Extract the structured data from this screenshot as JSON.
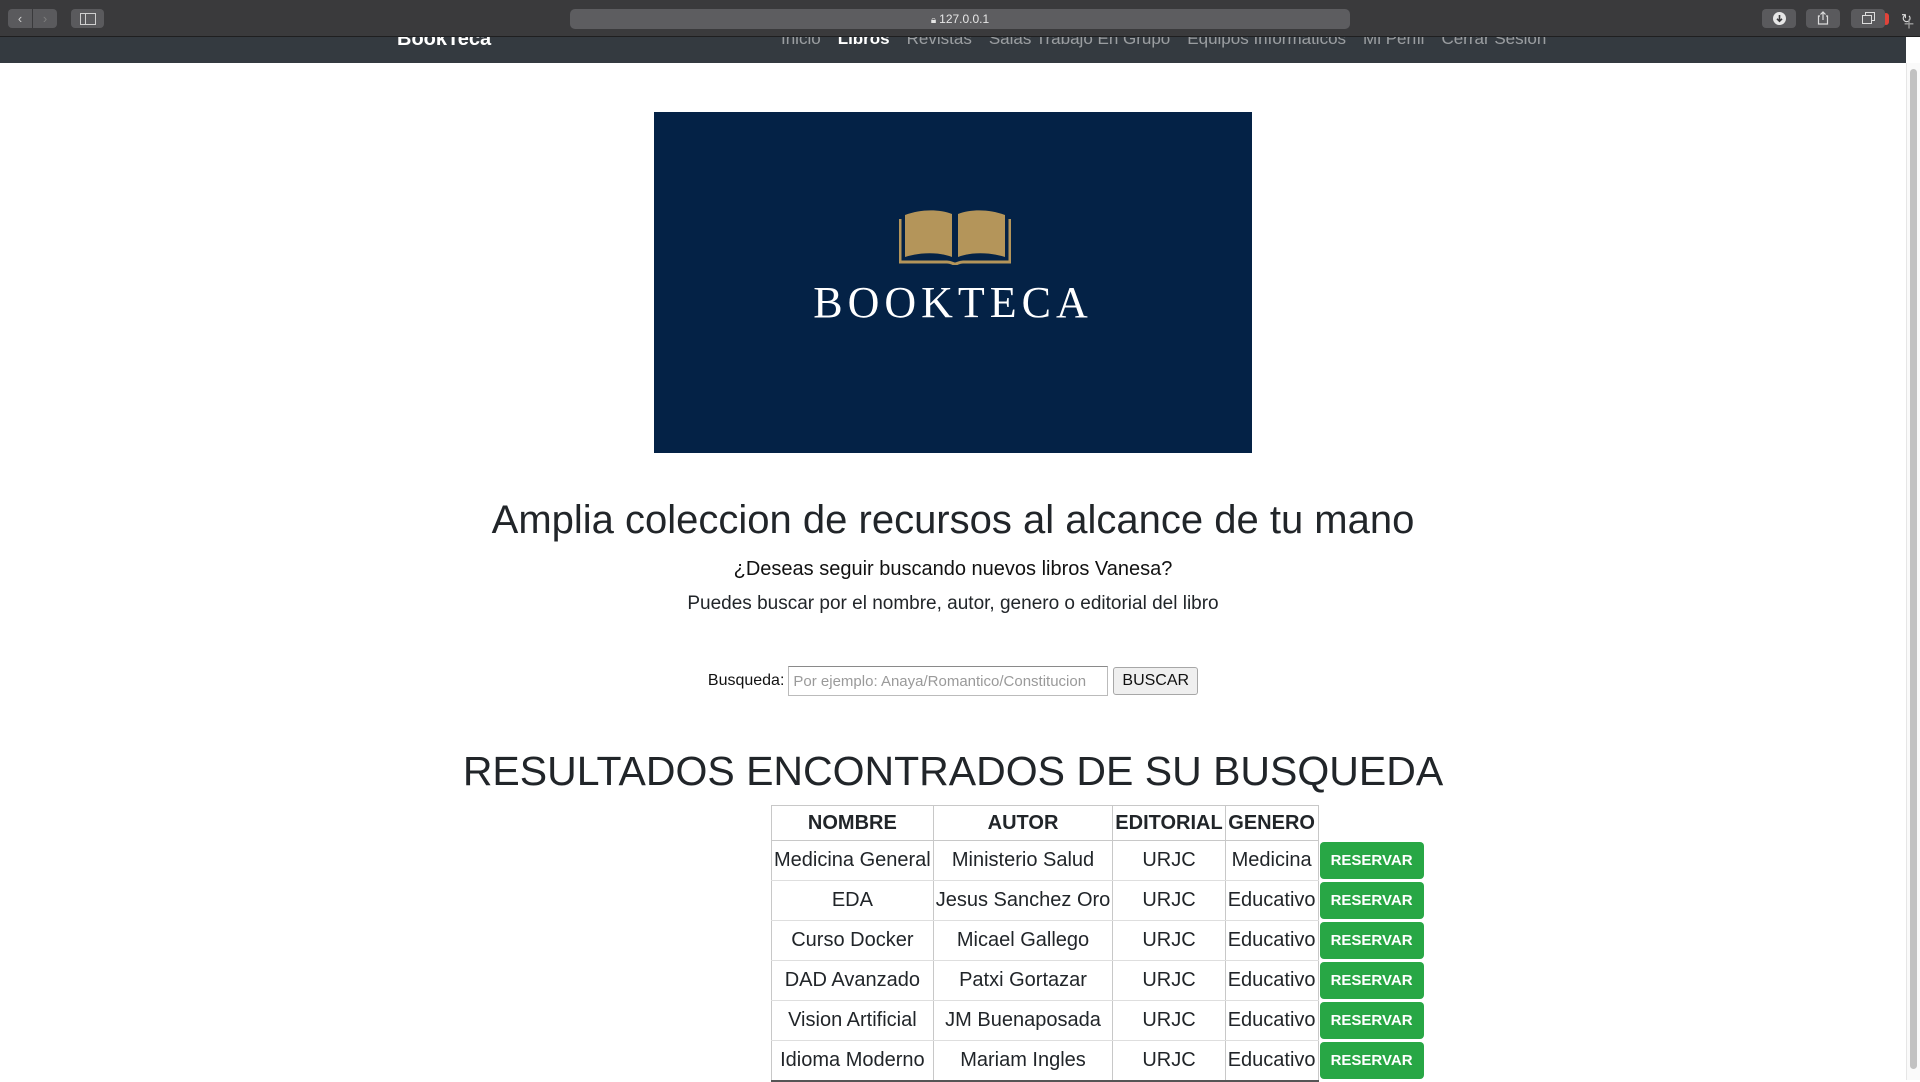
{
  "browser": {
    "url": "127.0.0.1"
  },
  "navbar": {
    "brand": "BookTeca",
    "links": [
      {
        "label": "Inicio"
      },
      {
        "label": "Libros"
      },
      {
        "label": "Revistas"
      },
      {
        "label": "Salas Trabajo En Grupo"
      },
      {
        "label": "Equipos Informaticos"
      },
      {
        "label": "Mi Perfil"
      },
      {
        "label": "Cerrar Sesion"
      }
    ],
    "active": "Libros"
  },
  "hero": {
    "title": "BOOKTECA",
    "background_color": "#042246",
    "icon_color": "#b4955a"
  },
  "main": {
    "heading": "Amplia coleccion de recursos al alcance de tu mano",
    "question": "¿Deseas seguir buscando nuevos libros Vanesa?",
    "hint": "Puedes buscar por el nombre, autor, genero o editorial del libro"
  },
  "search": {
    "label": "Busqueda:",
    "placeholder": "Por ejemplo: Anaya/Romantico/Constitucion",
    "value": "",
    "button": "BUSCAR"
  },
  "results": {
    "heading": "RESULTADOS ENCONTRADOS DE SU BUSQUEDA",
    "columns": [
      "NOMBRE",
      "AUTOR",
      "EDITORIAL",
      "GENERO"
    ],
    "rows": [
      {
        "nombre": "Medicina General",
        "autor": "Ministerio Salud",
        "editorial": "URJC",
        "genero": "Medicina",
        "action": "RESERVAR"
      },
      {
        "nombre": "EDA",
        "autor": "Jesus Sanchez Oro",
        "editorial": "URJC",
        "genero": "Educativo",
        "action": "RESERVAR"
      },
      {
        "nombre": "Curso Docker",
        "autor": "Micael Gallego",
        "editorial": "URJC",
        "genero": "Educativo",
        "action": "RESERVAR"
      },
      {
        "nombre": "DAD Avanzado",
        "autor": "Patxi Gortazar",
        "editorial": "URJC",
        "genero": "Educativo",
        "action": "RESERVAR"
      },
      {
        "nombre": "Vision Artificial",
        "autor": "JM Buenaposada",
        "editorial": "URJC",
        "genero": "Educativo",
        "action": "RESERVAR"
      },
      {
        "nombre": "Idioma Moderno",
        "autor": "Mariam Ingles",
        "editorial": "URJC",
        "genero": "Educativo",
        "action": "RESERVAR"
      }
    ],
    "button_color": "#28a745"
  }
}
